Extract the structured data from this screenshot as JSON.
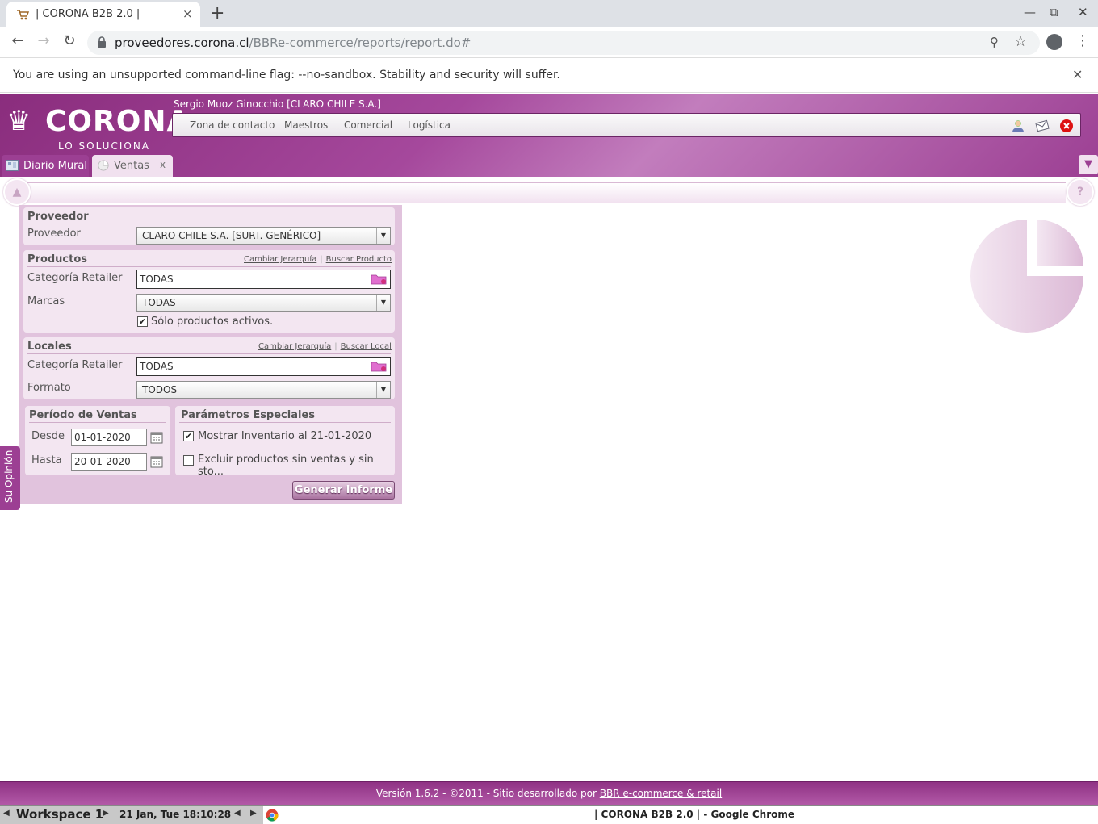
{
  "browser": {
    "tab_title": "| CORONA B2B 2.0 |",
    "tab_close": "×",
    "new_tab": "+",
    "url_host": "proveedores.corona.cl",
    "url_path": "/BBRe-commerce/reports/report.do#",
    "infobar_message": "You are using an unsupported command-line flag: --no-sandbox. Stability and security will suffer.",
    "infobar_close": "✕"
  },
  "app": {
    "logo_brand": "CORONA",
    "logo_tagline": "LO SOLUCIONA",
    "user": "Sergio Muoz Ginocchio [CLARO CHILE S.A.]",
    "menu": [
      "Zona de contacto",
      "Maestros",
      "Comercial",
      "Logística"
    ],
    "tabs": [
      {
        "label": "Diario Mural"
      },
      {
        "label": "Ventas",
        "close": "x"
      }
    ]
  },
  "form": {
    "proveedor": {
      "title": "Proveedor",
      "label": "Proveedor",
      "value": "CLARO CHILE S.A. [SURT. GENÉRICO]"
    },
    "productos": {
      "title": "Productos",
      "link1": "Cambiar Jerarquía",
      "link2": "Buscar Producto",
      "categoria_label": "Categoría Retailer",
      "categoria_value": "TODAS",
      "marcas_label": "Marcas",
      "marcas_value": "TODAS",
      "activos_label": "Sólo productos activos.",
      "activos_checked": true
    },
    "locales": {
      "title": "Locales",
      "link1": "Cambiar Jerarquía",
      "link2": "Buscar Local",
      "categoria_label": "Categoría Retailer",
      "categoria_value": "TODAS",
      "formato_label": "Formato",
      "formato_value": "TODOS"
    },
    "periodo": {
      "title": "Período de Ventas",
      "desde_label": "Desde",
      "desde_value": "01-01-2020",
      "hasta_label": "Hasta",
      "hasta_value": "20-01-2020"
    },
    "parametros": {
      "title": "Parámetros Especiales",
      "inventario_label": "Mostrar Inventario al 21-01-2020",
      "inventario_checked": true,
      "excluir_label": "Excluir productos sin ventas y sin sto...",
      "excluir_checked": false
    },
    "submit": "Generar Informe"
  },
  "side_tab": "Su Opinión",
  "footer": {
    "text": "Versión 1.6.2 - ©2011 - Sitio desarrollado por ",
    "link": "BBR e-commerce & retail"
  },
  "taskbar": {
    "workspace": "Workspace 1",
    "clock": "21 Jan, Tue 18:10:28",
    "window_title": "| CORONA B2B 2.0 | - Google Chrome"
  },
  "colors": {
    "brand_purple": "#9c3f93",
    "panel_bg": "#e1c3dd",
    "section_bg": "#f3e6f1"
  }
}
